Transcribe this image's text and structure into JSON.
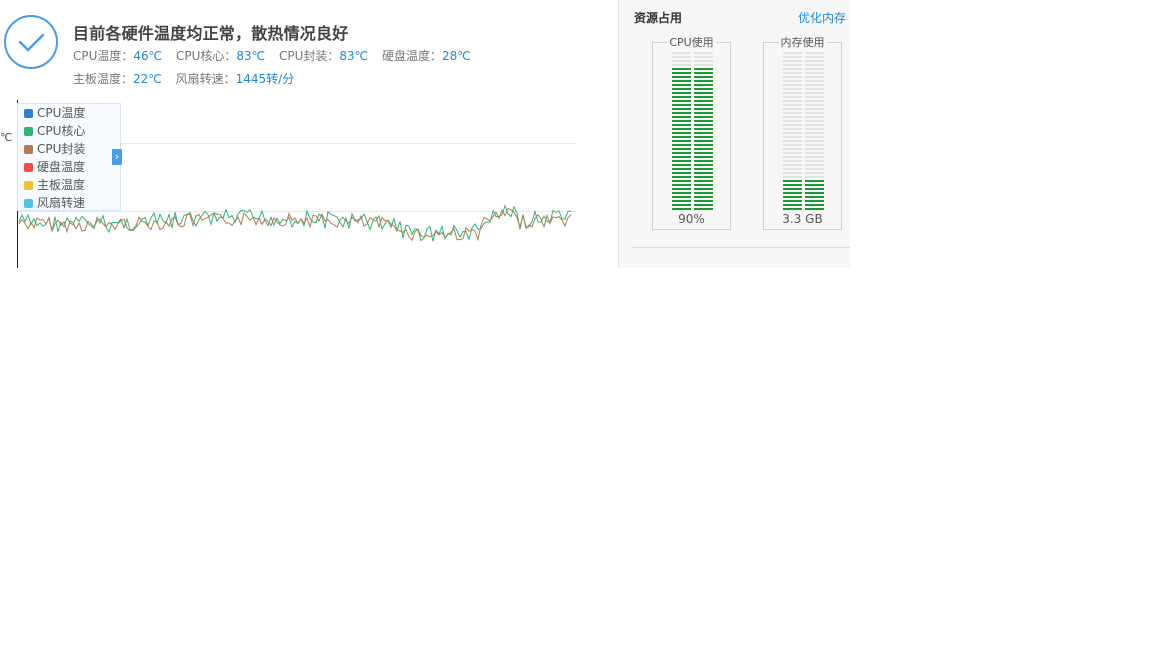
{
  "header": {
    "title": "目前各硬件温度均正常，散热情况良好",
    "temps_row1": [
      {
        "label": "CPU温度：",
        "value": "46℃"
      },
      {
        "label": "CPU核心：",
        "value": "83℃"
      },
      {
        "label": "CPU封装：",
        "value": "83℃"
      },
      {
        "label": "硬盘温度：",
        "value": "28℃"
      }
    ],
    "temps_row2": [
      {
        "label": "主板温度：",
        "value": "22℃"
      },
      {
        "label": "风扇转速：",
        "value": "1445转/分"
      }
    ]
  },
  "chart": {
    "unit_label": "℃",
    "tick_label": "",
    "legend": [
      {
        "name": "CPU温度",
        "color": "#2e7fd6"
      },
      {
        "name": "CPU核心",
        "color": "#2fb37a"
      },
      {
        "name": "CPU封装",
        "color": "#b07a52"
      },
      {
        "name": "硬盘温度",
        "color": "#ef4b4b"
      },
      {
        "name": "主板温度",
        "color": "#f2c12e"
      },
      {
        "name": "风扇转速",
        "color": "#52c3e8"
      }
    ],
    "toggle_icon": "chevron-right-icon"
  },
  "resources": {
    "title": "资源占用",
    "optimize_link": "优化内存",
    "cpu": {
      "label": "CPU使用",
      "value": "90%",
      "fraction": 0.9
    },
    "memory": {
      "label": "内存使用",
      "value": "3.3 GB",
      "fraction": 0.2
    },
    "bar_color": "#1f9638",
    "bar_empty_color": "#e2e2e2"
  }
}
